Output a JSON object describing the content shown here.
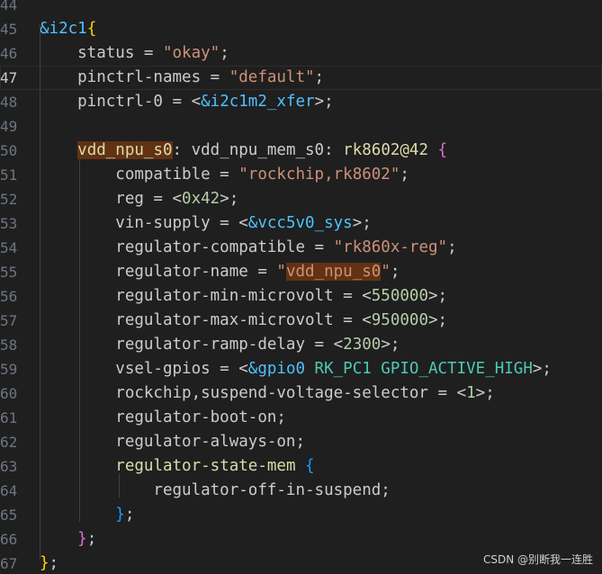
{
  "colors": {
    "background": "#1f1f1f",
    "plain": "#cccccc",
    "property": "#9cdcfe",
    "string": "#ce9178",
    "reference": "#4fc1ff",
    "label": "#dcdcaa",
    "number": "#b5cea8",
    "constant": "#4ec9b0",
    "bracket_gold": "#ffd700",
    "bracket_purple": "#da70d6",
    "bracket_blue": "#179fff",
    "highlight_bg": "#613214"
  },
  "lines": [
    {
      "num": "44",
      "tokens": []
    },
    {
      "num": "45",
      "tokens": [
        {
          "text": "&i2c1",
          "c": "ref"
        },
        {
          "text": "{",
          "c": "gold"
        }
      ]
    },
    {
      "num": "46",
      "tokens": [
        {
          "text": "    status = ",
          "c": "plain"
        },
        {
          "text": "\"okay\"",
          "c": "string"
        },
        {
          "text": ";",
          "c": "plain"
        }
      ]
    },
    {
      "num": "47",
      "tokens": [
        {
          "text": "    pinctrl-names = ",
          "c": "plain"
        },
        {
          "text": "\"default\"",
          "c": "string"
        },
        {
          "text": ";",
          "c": "plain"
        }
      ]
    },
    {
      "num": "48",
      "tokens": [
        {
          "text": "    pinctrl-0 = <",
          "c": "plain"
        },
        {
          "text": "&i2c1m2_xfer",
          "c": "ref"
        },
        {
          "text": ">;",
          "c": "plain"
        }
      ]
    },
    {
      "num": "49",
      "tokens": []
    },
    {
      "num": "50",
      "tokens": [
        {
          "text": "    ",
          "c": "plain"
        },
        {
          "text": "vdd_npu_s0",
          "c": "label",
          "hl": true
        },
        {
          "text": ": vdd_npu_mem_s0: ",
          "c": "plain"
        },
        {
          "text": "rk8602@42",
          "c": "label"
        },
        {
          "text": " ",
          "c": "plain"
        },
        {
          "text": "{",
          "c": "purple"
        }
      ]
    },
    {
      "num": "51",
      "tokens": [
        {
          "text": "        compatible = ",
          "c": "plain"
        },
        {
          "text": "\"rockchip,rk8602\"",
          "c": "string"
        },
        {
          "text": ";",
          "c": "plain"
        }
      ]
    },
    {
      "num": "52",
      "tokens": [
        {
          "text": "        reg = <",
          "c": "plain"
        },
        {
          "text": "0x42",
          "c": "number"
        },
        {
          "text": ">;",
          "c": "plain"
        }
      ]
    },
    {
      "num": "53",
      "tokens": [
        {
          "text": "        vin-supply = <",
          "c": "plain"
        },
        {
          "text": "&vcc5v0_sys",
          "c": "ref"
        },
        {
          "text": ">;",
          "c": "plain"
        }
      ]
    },
    {
      "num": "54",
      "tokens": [
        {
          "text": "        regulator-compatible = ",
          "c": "plain"
        },
        {
          "text": "\"rk860x-reg\"",
          "c": "string"
        },
        {
          "text": ";",
          "c": "plain"
        }
      ]
    },
    {
      "num": "55",
      "tokens": [
        {
          "text": "        regulator-name = ",
          "c": "plain"
        },
        {
          "text": "\"",
          "c": "string"
        },
        {
          "text": "vdd_npu_s0",
          "c": "string",
          "hl": true
        },
        {
          "text": "\"",
          "c": "string"
        },
        {
          "text": ";",
          "c": "plain"
        }
      ]
    },
    {
      "num": "56",
      "tokens": [
        {
          "text": "        regulator-min-microvolt = <",
          "c": "plain"
        },
        {
          "text": "550000",
          "c": "number"
        },
        {
          "text": ">;",
          "c": "plain"
        }
      ]
    },
    {
      "num": "57",
      "tokens": [
        {
          "text": "        regulator-max-microvolt = <",
          "c": "plain"
        },
        {
          "text": "950000",
          "c": "number"
        },
        {
          "text": ">;",
          "c": "plain"
        }
      ]
    },
    {
      "num": "58",
      "tokens": [
        {
          "text": "        regulator-ramp-delay = <",
          "c": "plain"
        },
        {
          "text": "2300",
          "c": "number"
        },
        {
          "text": ">;",
          "c": "plain"
        }
      ]
    },
    {
      "num": "59",
      "tokens": [
        {
          "text": "        vsel-gpios = <",
          "c": "plain"
        },
        {
          "text": "&gpio0",
          "c": "ref"
        },
        {
          "text": " RK_PC1 GPIO_ACTIVE_HIGH",
          "c": "constant"
        },
        {
          "text": ">;",
          "c": "plain"
        }
      ]
    },
    {
      "num": "60",
      "tokens": [
        {
          "text": "        rockchip,suspend-voltage-selector = <",
          "c": "plain"
        },
        {
          "text": "1",
          "c": "number"
        },
        {
          "text": ">;",
          "c": "plain"
        }
      ]
    },
    {
      "num": "61",
      "tokens": [
        {
          "text": "        regulator-boot-on;",
          "c": "plain"
        }
      ]
    },
    {
      "num": "62",
      "tokens": [
        {
          "text": "        regulator-always-on;",
          "c": "plain"
        }
      ]
    },
    {
      "num": "63",
      "tokens": [
        {
          "text": "        ",
          "c": "plain"
        },
        {
          "text": "regulator-state-mem",
          "c": "label"
        },
        {
          "text": " ",
          "c": "plain"
        },
        {
          "text": "{",
          "c": "blue"
        }
      ]
    },
    {
      "num": "64",
      "tokens": [
        {
          "text": "            regulator-off-in-suspend;",
          "c": "plain"
        }
      ]
    },
    {
      "num": "65",
      "tokens": [
        {
          "text": "        ",
          "c": "plain"
        },
        {
          "text": "}",
          "c": "blue"
        },
        {
          "text": ";",
          "c": "plain"
        }
      ]
    },
    {
      "num": "66",
      "tokens": [
        {
          "text": "    ",
          "c": "plain"
        },
        {
          "text": "}",
          "c": "purple"
        },
        {
          "text": ";",
          "c": "plain"
        }
      ]
    },
    {
      "num": "67",
      "tokens": [
        {
          "text": "}",
          "c": "gold"
        },
        {
          "text": ";",
          "c": "plain"
        }
      ]
    }
  ],
  "active_line": "47",
  "watermark": "CSDN @别断我一连胜"
}
